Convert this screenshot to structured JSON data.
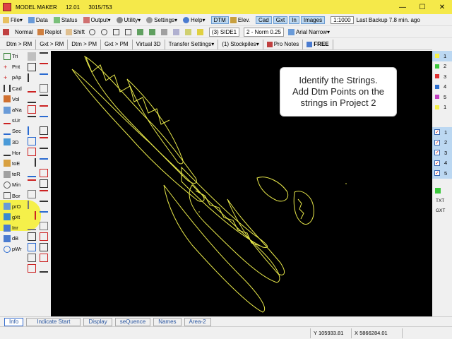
{
  "window": {
    "app_name": "MODEL MAKER",
    "version": "12.01",
    "build": "3015/753",
    "minimize": "—",
    "maximize": "☐",
    "close": "✕"
  },
  "menu": {
    "file": "File",
    "data": "Data",
    "status": "Status",
    "output": "Output",
    "utility": "Utility",
    "settings": "Settings",
    "help": "Help",
    "dtm": "DTM",
    "elev": "Elev.",
    "cad": "Cad",
    "gxt": "Gxt",
    "in": "In",
    "images": "Images",
    "scale": "1:1000",
    "last_backup": "Last Backup 7.8 min. ago"
  },
  "toolbar": {
    "normal": "Normal",
    "replot": "Replot",
    "shift": "Shift",
    "layer": "(3) SIDE1",
    "pen": "2 - Norm 0.25",
    "font": "Arial Narrow"
  },
  "tabs": {
    "t1": "Dtm > RM",
    "t2": "Gxt > RM",
    "t3": "Dtm > PM",
    "t4": "Gxt > PM",
    "t5": "Virtual 3D",
    "t6": "Transfer Settings",
    "t7": "(1) Stockpiles",
    "t8": "Pro Notes",
    "t9": "FREE"
  },
  "left_tools": [
    {
      "label": "Tri"
    },
    {
      "label": "Pnt"
    },
    {
      "label": "pAp"
    },
    {
      "label": "Cad"
    },
    {
      "label": "Vol"
    },
    {
      "label": "aNa"
    },
    {
      "label": "sUr"
    },
    {
      "label": "Sec"
    },
    {
      "label": "3D"
    },
    {
      "label": "Hor"
    },
    {
      "label": "toE"
    },
    {
      "label": "teR"
    },
    {
      "label": "Min"
    },
    {
      "label": "Bor"
    },
    {
      "label": "prO"
    },
    {
      "label": "gXt"
    },
    {
      "label": "Inr"
    },
    {
      "label": "dB"
    },
    {
      "label": "pWr"
    }
  ],
  "callout": {
    "line1": "Identify the Strings.",
    "line2": "Add Dtm Points on the",
    "line3": "strings in Project 2"
  },
  "right_layers": {
    "colors": [
      {
        "label": "1",
        "color": "#f5f04a"
      },
      {
        "label": "2",
        "color": "#3cc83c"
      },
      {
        "label": "3",
        "color": "#e03030"
      },
      {
        "label": "4",
        "color": "#2c6fd0"
      },
      {
        "label": "5",
        "color": "#c040c0"
      },
      {
        "label": "1",
        "color": "#f5f04a"
      }
    ],
    "checks": [
      {
        "label": "1"
      },
      {
        "label": "2"
      },
      {
        "label": "3"
      },
      {
        "label": "4"
      },
      {
        "label": "5"
      }
    ],
    "txt": "TXT",
    "gxt": "GXT"
  },
  "bottom_tabs": {
    "info": "Info",
    "indicate": "Indicate Start",
    "display": "Display",
    "sequence": "seQuence",
    "names": "Names",
    "area": "Area-2"
  },
  "status": {
    "y": "Y 105933.81",
    "x": "X 5866284.01"
  },
  "colors": {
    "string_color": "#e8e84a",
    "canvas": "#000000",
    "titlebar": "#f5e94a"
  }
}
